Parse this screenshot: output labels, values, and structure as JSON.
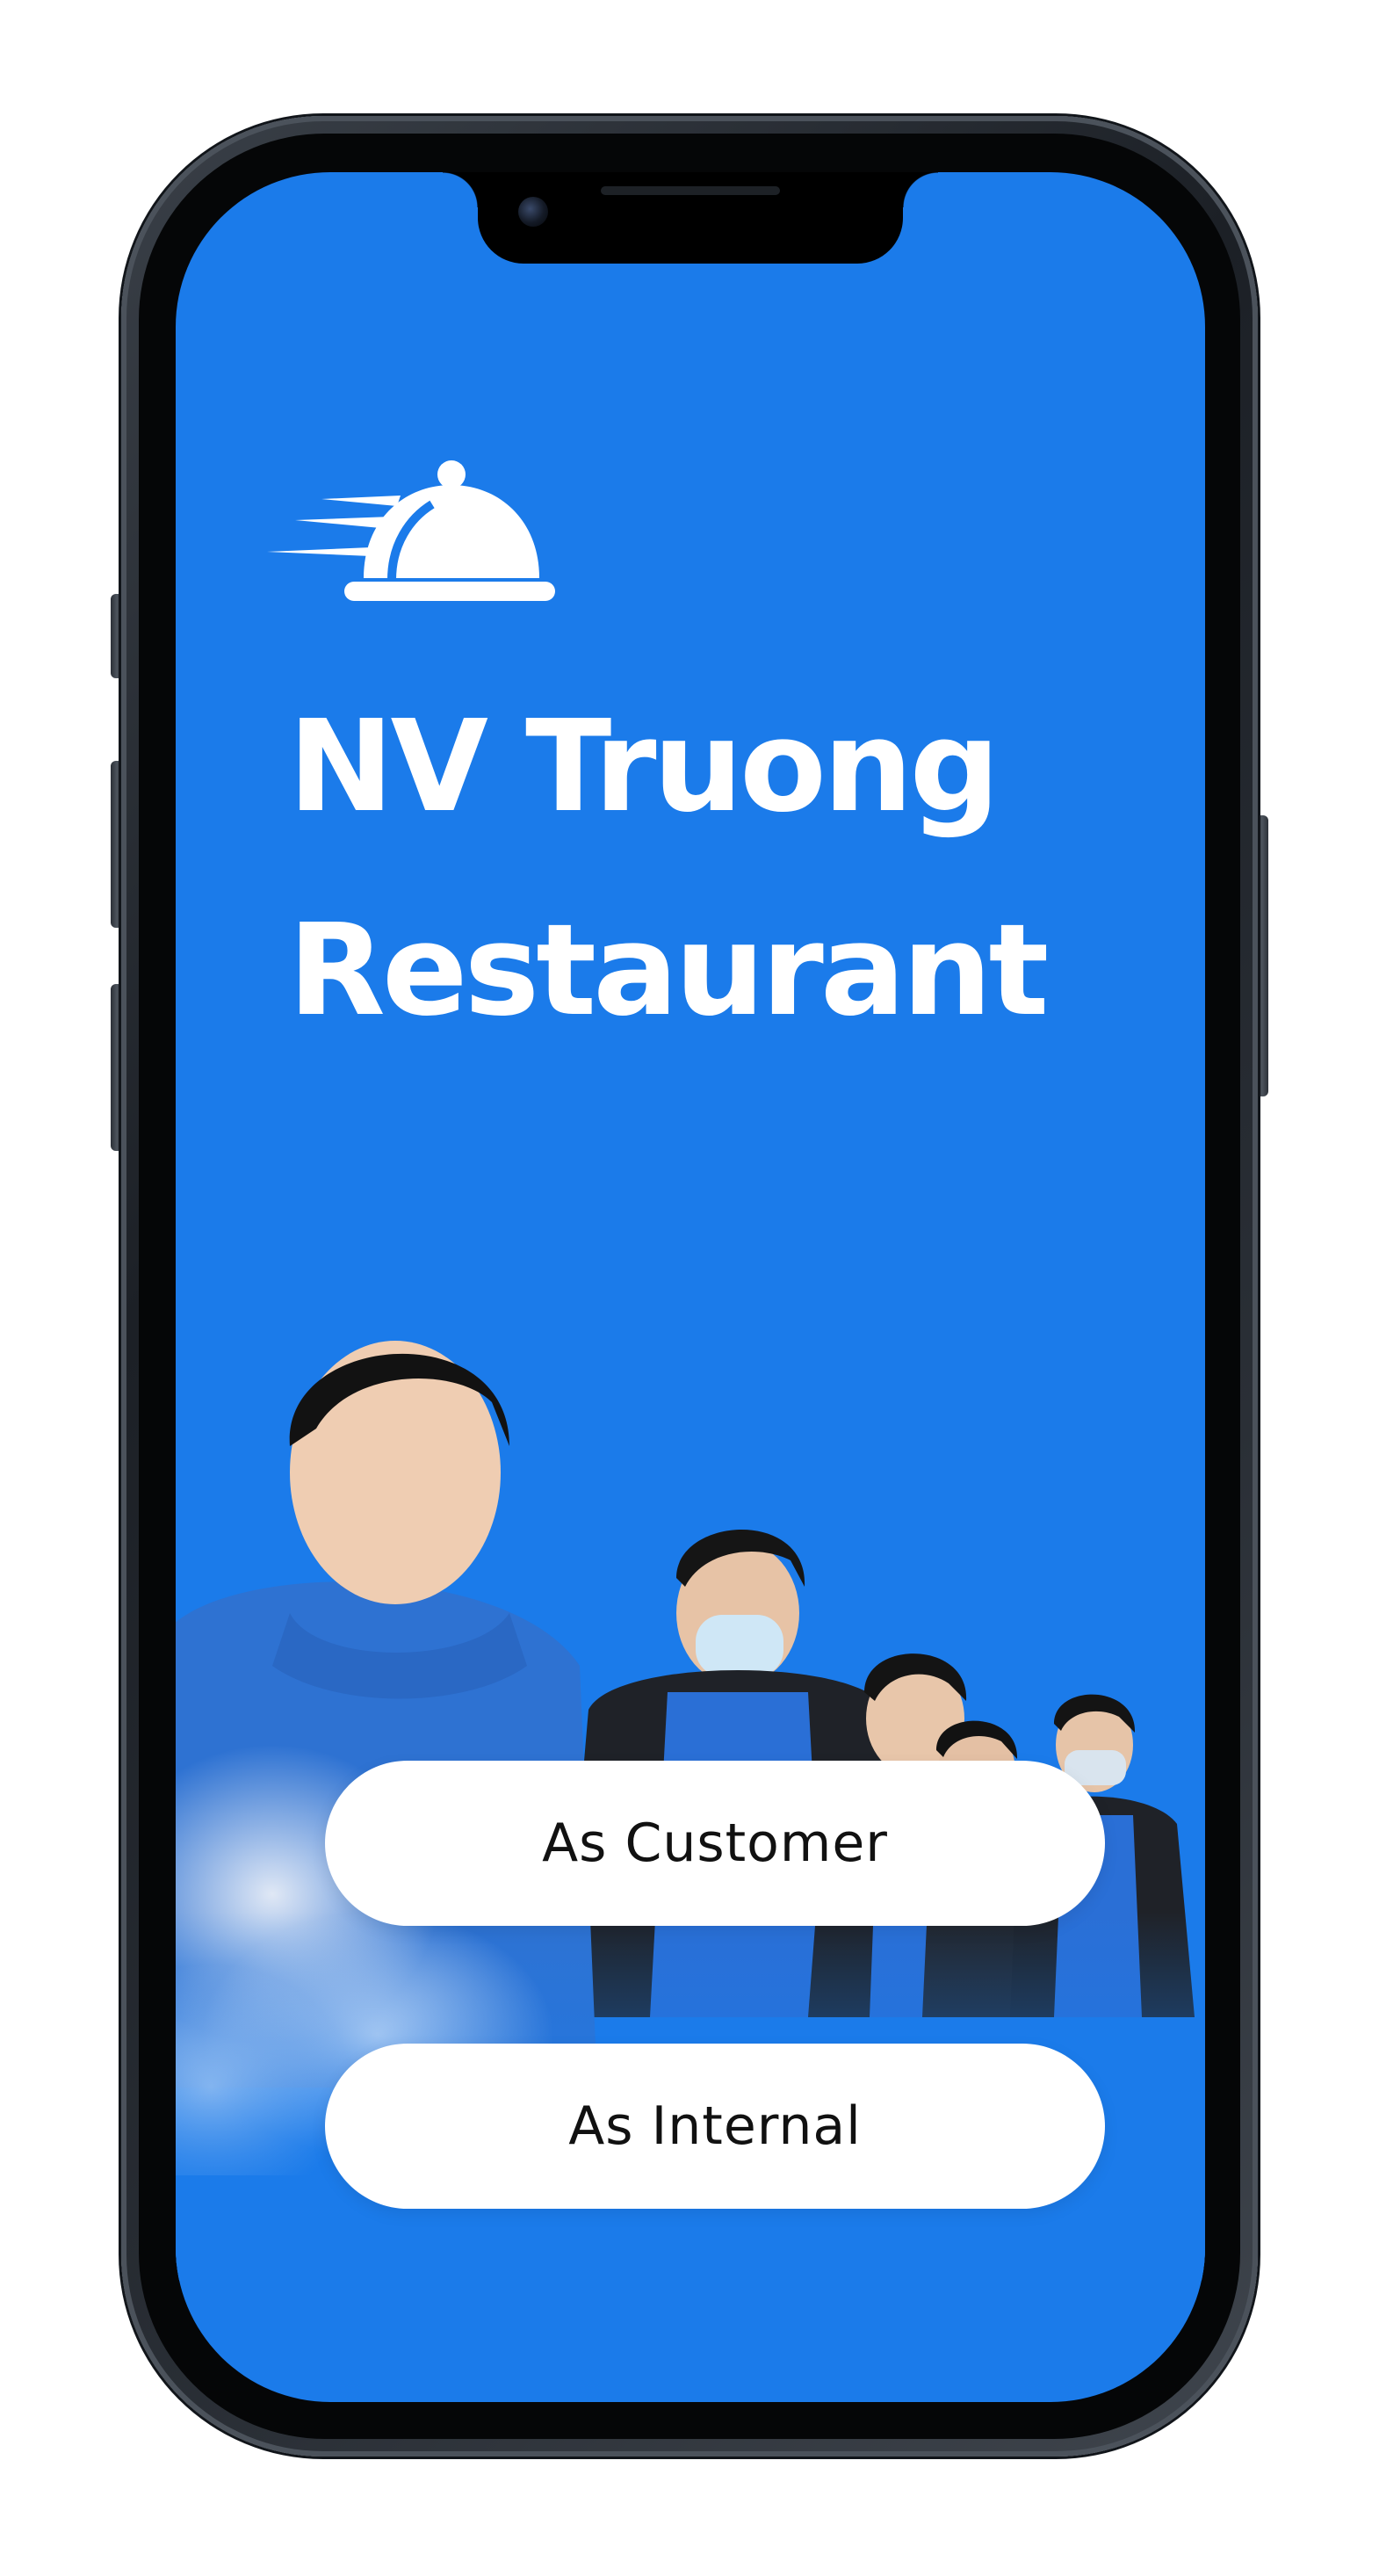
{
  "app": {
    "title_line_1": "NV Truong",
    "title_line_2": "Restaurant",
    "logo_icon": "cloche-food-delivery-icon"
  },
  "actions": {
    "customer_label": "As Customer",
    "internal_label": "As Internal"
  },
  "colors": {
    "screen_background": "#1b7bea",
    "title_text": "#ffffff",
    "button_background": "#ffffff",
    "button_text": "#111111"
  }
}
